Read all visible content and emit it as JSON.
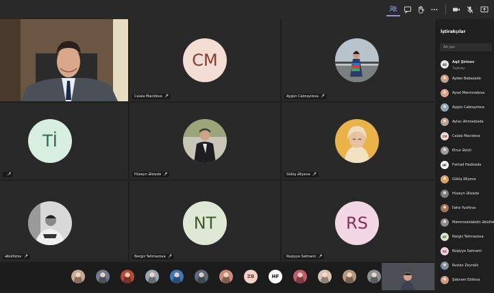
{
  "toolbar": {
    "icons": [
      "participants-icon",
      "chat-icon",
      "raise-hand-icon",
      "more-icon",
      "camera-icon",
      "mic-icon",
      "share-icon"
    ]
  },
  "tiles": [
    {
      "name": "",
      "kind": "video-presenter"
    },
    {
      "name": "Calala Macidova",
      "initials": "CM",
      "bg": "#f4ddd4",
      "fg": "#8a3a2a"
    },
    {
      "name": "Aygün Cabrayılova",
      "kind": "photo"
    },
    {
      "name": "",
      "initials": "Tİ",
      "bg": "#d8eee0",
      "fg": "#2c6b46"
    },
    {
      "name": "Hüseyn Əlizadə",
      "kind": "photo"
    },
    {
      "name": "Gülüş Əliyeva",
      "kind": "photo"
    },
    {
      "name": "Əbülfətov",
      "kind": "photo"
    },
    {
      "name": "Nərgiz Tahmazova",
      "initials": "NT",
      "bg": "#dfe8d4",
      "fg": "#3d5a2a"
    },
    {
      "name": "Ruqiyyə Salmanlı",
      "initials": "RS",
      "bg": "#f2d7e4",
      "fg": "#8a2d5c"
    }
  ],
  "strip": {
    "avatars": [
      {
        "initials": "",
        "bg": "#c9a892"
      },
      {
        "initials": "",
        "bg": "#6b7c8c"
      },
      {
        "initials": "",
        "bg": "#b44a3c"
      },
      {
        "initials": "",
        "bg": "#9aa7b3"
      },
      {
        "initials": "",
        "bg": "#3f78b5"
      },
      {
        "initials": "",
        "bg": "#5b6b7d"
      },
      {
        "initials": "",
        "bg": "#c78d7a"
      },
      {
        "initials": "ZB",
        "bg": "#f2d1c8",
        "fg": "#7a3b2a"
      },
      {
        "initials": "HF",
        "bg": "#ffffff",
        "fg": "#111111"
      },
      {
        "initials": "",
        "bg": "#c45b6a"
      },
      {
        "initials": "",
        "bg": "#d9c4b8"
      },
      {
        "initials": "",
        "bg": "#b6967e"
      },
      {
        "initials": "",
        "bg": "#8a8f94"
      }
    ]
  },
  "panel": {
    "title": "İştirakçılar",
    "search_placeholder": "Ad yaz",
    "participants": [
      {
        "name": "Aqil Şirinov",
        "role": "Təşkilatçı",
        "initials": "AŞ",
        "bg": "#e8e8e8",
        "fg": "#333"
      },
      {
        "name": "Aydan Babazadə",
        "initials": "",
        "bg": "#c7a08a"
      },
      {
        "name": "Aysel Məmmədova",
        "initials": "",
        "bg": "#d7a58f"
      },
      {
        "name": "Aygün Cabrayılova",
        "initials": "",
        "bg": "#8fa4b6"
      },
      {
        "name": "Aytac Əhmədzadə",
        "initials": "",
        "bg": "#b8a39a"
      },
      {
        "name": "Calala Macidova",
        "initials": "CM",
        "bg": "#f4ddd4",
        "fg": "#8a3a2a"
      },
      {
        "name": "Elnur Əzizli",
        "initials": "",
        "bg": "#9c9c9c"
      },
      {
        "name": "Fərhad Hadizadə",
        "initials": "HF",
        "bg": "#ffffff",
        "fg": "#111"
      },
      {
        "name": "Gülüş Əliyeva",
        "initials": "",
        "bg": "#d3a26a"
      },
      {
        "name": "Hüseyn Əlizadə",
        "initials": "",
        "bg": "#7a7f86"
      },
      {
        "name": "İlahə Yusifova",
        "initials": "",
        "bg": "#a07560"
      },
      {
        "name": "Məmmədəlabdin Əbülfət",
        "initials": "",
        "bg": "#8c8c8c"
      },
      {
        "name": "Nərgiz Tahmazova",
        "initials": "NT",
        "bg": "#dfe8d4",
        "fg": "#3d5a2a"
      },
      {
        "name": "Ruqiyyə Salmanlı",
        "initials": "RS",
        "bg": "#f2d7e4",
        "fg": "#8a2d5c"
      },
      {
        "name": "Ruslan Zeynallı",
        "initials": "",
        "bg": "#7d8f9c"
      },
      {
        "name": "Şəbnəm Edilova",
        "initials": "",
        "bg": "#c99b84"
      }
    ]
  }
}
